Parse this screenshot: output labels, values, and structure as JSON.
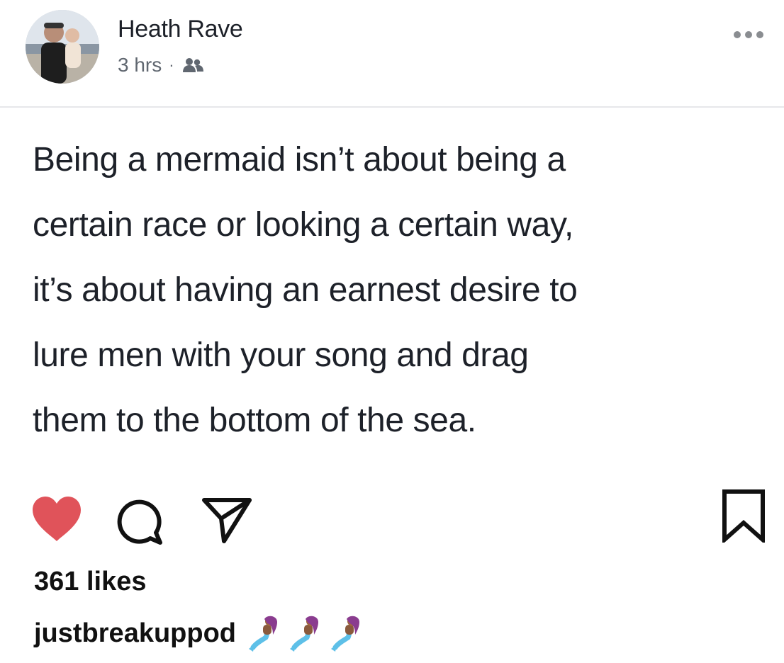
{
  "post": {
    "author_name": "Heath Rave",
    "timestamp": "3 hrs",
    "separator": "·",
    "audience_icon": "friends-icon",
    "text": "Being a mermaid isn’t about being a\ncertain race or looking a certain way,\nit’s about having an earnest desire to\nlure men with your song and drag\nthem to the bottom of the sea."
  },
  "actions": {
    "like_icon": "heart-icon",
    "like_color": "#e0535a",
    "comment_icon": "comment-icon",
    "share_icon": "paper-plane-icon",
    "save_icon": "bookmark-icon"
  },
  "likes_text": "361 likes",
  "caption": {
    "username": "justbreakuppod",
    "emojis": [
      "mermaid-icon",
      "mermaid-icon",
      "mermaid-icon"
    ]
  }
}
